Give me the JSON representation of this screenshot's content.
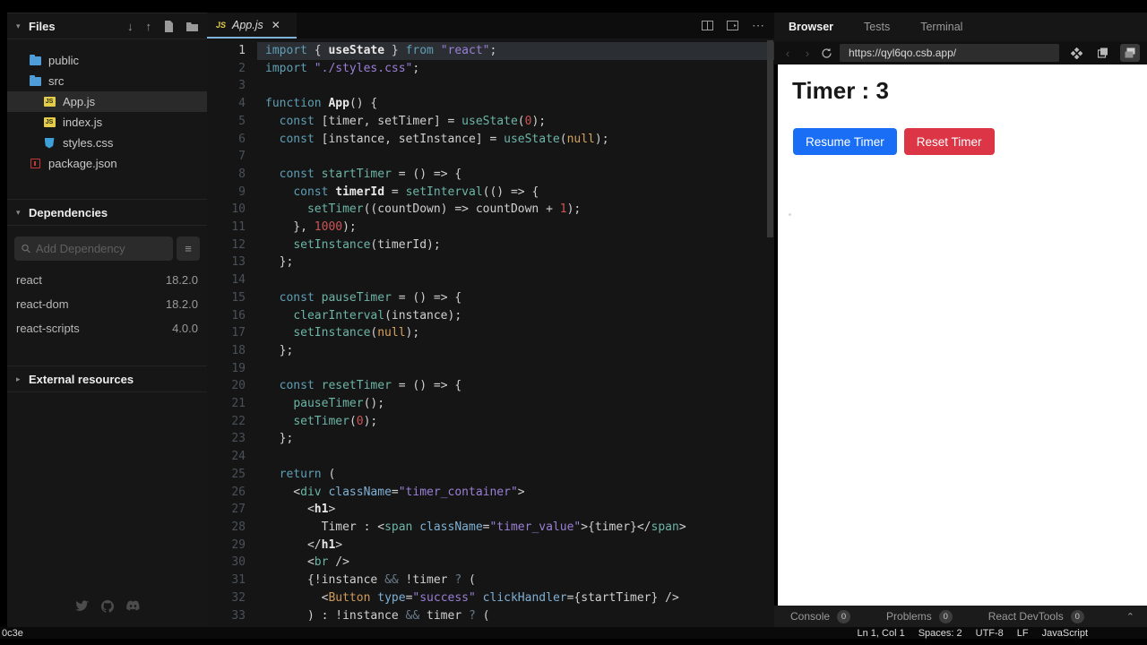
{
  "sidebar": {
    "files_header": "Files",
    "files": [
      {
        "name": "public",
        "icon": "folder",
        "indent": 1,
        "selected": false
      },
      {
        "name": "src",
        "icon": "folder",
        "indent": 1,
        "selected": false
      },
      {
        "name": "App.js",
        "icon": "js",
        "indent": 2,
        "selected": true
      },
      {
        "name": "index.js",
        "icon": "js",
        "indent": 2,
        "selected": false
      },
      {
        "name": "styles.css",
        "icon": "css",
        "indent": 2,
        "selected": false
      },
      {
        "name": "package.json",
        "icon": "npm",
        "indent": 1,
        "selected": false
      }
    ],
    "dependencies_header": "Dependencies",
    "search_placeholder": "Add Dependency",
    "dependencies": [
      {
        "name": "react",
        "version": "18.2.0"
      },
      {
        "name": "react-dom",
        "version": "18.2.0"
      },
      {
        "name": "react-scripts",
        "version": "4.0.0"
      }
    ],
    "external_header": "External resources"
  },
  "editor": {
    "tab_icon": "JS",
    "tab_title": "App.js",
    "close_glyph": "✕",
    "active_line": 1,
    "lines": [
      [
        [
          "kw",
          "import"
        ],
        " { ",
        [
          "var",
          "useState"
        ],
        " } ",
        [
          "kw",
          "from"
        ],
        " ",
        [
          "str",
          "\"react\""
        ],
        ";"
      ],
      [
        [
          "kw",
          "import"
        ],
        " ",
        [
          "str",
          "\"./styles.css\""
        ],
        ";"
      ],
      [],
      [
        [
          "kw",
          "function"
        ],
        " ",
        [
          "var",
          "App"
        ],
        "() {"
      ],
      [
        "  ",
        [
          "kw",
          "const"
        ],
        " [timer, setTimer] = ",
        [
          "fn",
          "useState"
        ],
        "(",
        [
          "num",
          "0"
        ],
        ");"
      ],
      [
        "  ",
        [
          "kw",
          "const"
        ],
        " [instance, setInstance] = ",
        [
          "fn",
          "useState"
        ],
        "(",
        [
          "nul",
          "null"
        ],
        ");"
      ],
      [],
      [
        "  ",
        [
          "kw",
          "const"
        ],
        " ",
        [
          "fn",
          "startTimer"
        ],
        " = () => {"
      ],
      [
        "    ",
        [
          "kw",
          "const"
        ],
        " ",
        [
          "var",
          "timerId"
        ],
        " = ",
        [
          "fn",
          "setInterval"
        ],
        "(() => {"
      ],
      [
        "      ",
        [
          "fn",
          "setTimer"
        ],
        "((countDown) => countDown + ",
        [
          "num",
          "1"
        ],
        ");"
      ],
      [
        "    }, ",
        [
          "num",
          "1000"
        ],
        ");"
      ],
      [
        "    ",
        [
          "fn",
          "setInstance"
        ],
        "(timerId);"
      ],
      [
        "  };"
      ],
      [],
      [
        "  ",
        [
          "kw",
          "const"
        ],
        " ",
        [
          "fn",
          "pauseTimer"
        ],
        " = () => {"
      ],
      [
        "    ",
        [
          "fn",
          "clearInterval"
        ],
        "(instance);"
      ],
      [
        "    ",
        [
          "fn",
          "setInstance"
        ],
        "(",
        [
          "nul",
          "null"
        ],
        ");"
      ],
      [
        "  };"
      ],
      [],
      [
        "  ",
        [
          "kw",
          "const"
        ],
        " ",
        [
          "fn",
          "resetTimer"
        ],
        " = () => {"
      ],
      [
        "    ",
        [
          "fn",
          "pauseTimer"
        ],
        "();"
      ],
      [
        "    ",
        [
          "fn",
          "setTimer"
        ],
        "(",
        [
          "num",
          "0"
        ],
        ");"
      ],
      [
        "  };"
      ],
      [],
      [
        "  ",
        [
          "kw",
          "return"
        ],
        " ("
      ],
      [
        "    <",
        [
          "tag",
          "div"
        ],
        " ",
        [
          "attr",
          "className"
        ],
        "=",
        [
          "str",
          "\"timer_container\""
        ],
        ">"
      ],
      [
        "      <",
        [
          "var",
          "h1"
        ],
        ">"
      ],
      [
        "        Timer : <",
        [
          "tag",
          "span"
        ],
        " ",
        [
          "attr",
          "className"
        ],
        "=",
        [
          "str",
          "\"timer_value\""
        ],
        ">{timer}</",
        [
          "tag",
          "span"
        ],
        ">"
      ],
      [
        "      </",
        [
          "var",
          "h1"
        ],
        ">"
      ],
      [
        "      <",
        [
          "tag",
          "br"
        ],
        " />"
      ],
      [
        "      {!instance ",
        [
          "op",
          "&&"
        ],
        " !timer ",
        [
          "op",
          "?"
        ],
        " ("
      ],
      [
        "        <",
        [
          "cmp",
          "Button"
        ],
        " ",
        [
          "attr",
          "type"
        ],
        "=",
        [
          "str",
          "\"success\""
        ],
        " ",
        [
          "attr",
          "clickHandler"
        ],
        "={startTimer} />"
      ],
      [
        "      ) : !instance ",
        [
          "op",
          "&&"
        ],
        " timer ",
        [
          "op",
          "?"
        ],
        " ("
      ]
    ]
  },
  "browser": {
    "tabs": [
      "Browser",
      "Tests",
      "Terminal"
    ],
    "active_tab": "Browser",
    "url": "https://qyl6qo.csb.app/",
    "preview": {
      "heading": "Timer : 3",
      "resume_label": "Resume Timer",
      "reset_label": "Reset Timer",
      "resume_color": "#1a6ef5",
      "reset_color": "#dc3545"
    },
    "console_bar": [
      {
        "label": "Console",
        "count": "0"
      },
      {
        "label": "Problems",
        "count": "0"
      },
      {
        "label": "React DevTools",
        "count": "0"
      }
    ]
  },
  "statusbar": {
    "left": "0c3e",
    "items": [
      "Ln 1, Col 1",
      "Spaces: 2",
      "UTF-8",
      "LF",
      "JavaScript"
    ]
  }
}
